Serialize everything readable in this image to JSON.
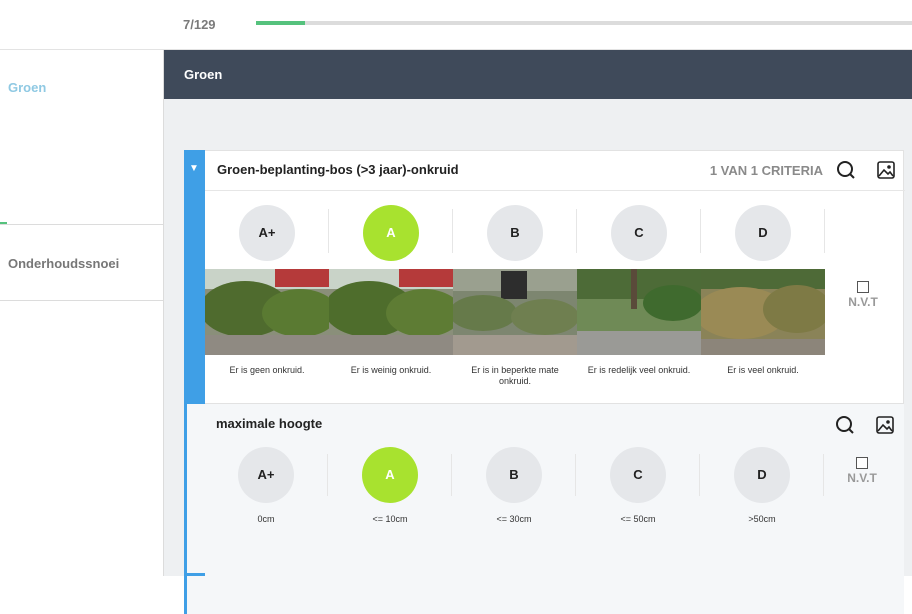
{
  "progress": {
    "label": "7/129",
    "fraction": 0.075
  },
  "sidebar": {
    "items": [
      {
        "label": "Groen",
        "active": true
      },
      {
        "label": "Onderhoudssnoei",
        "active": false
      }
    ]
  },
  "main": {
    "header": "Groen",
    "card1": {
      "title": "Groen-beplanting-bos (>3 jaar)-onkruid",
      "criteria": "1 VAN 1 CRITERIA",
      "grades": [
        {
          "label": "A+",
          "desc": "Er is geen onkruid.",
          "selected": false
        },
        {
          "label": "A",
          "desc": "Er is weinig onkruid.",
          "selected": true
        },
        {
          "label": "B",
          "desc": "Er is in beperkte mate onkruid.",
          "selected": false
        },
        {
          "label": "C",
          "desc": "Er is redelijk veel onkruid.",
          "selected": false
        },
        {
          "label": "D",
          "desc": "Er is veel onkruid.",
          "selected": false
        }
      ],
      "nvt": "N.V.T"
    },
    "card2": {
      "title": "maximale hoogte",
      "grades": [
        {
          "label": "A+",
          "desc": "0cm",
          "selected": false
        },
        {
          "label": "A",
          "desc": "<= 10cm",
          "selected": true
        },
        {
          "label": "B",
          "desc": "<= 30cm",
          "selected": false
        },
        {
          "label": "C",
          "desc": "<= 50cm",
          "selected": false
        },
        {
          "label": "D",
          "desc": ">50cm",
          "selected": false
        }
      ],
      "nvt": "N.V.T"
    }
  },
  "icons": {
    "search": "search-icon",
    "image": "image-icon",
    "collapse": "caret-down-icon"
  },
  "colors": {
    "accent": "#3f9fe6",
    "selected": "#a8e22f",
    "header": "#3f4a5a",
    "progress": "#55c27d"
  }
}
